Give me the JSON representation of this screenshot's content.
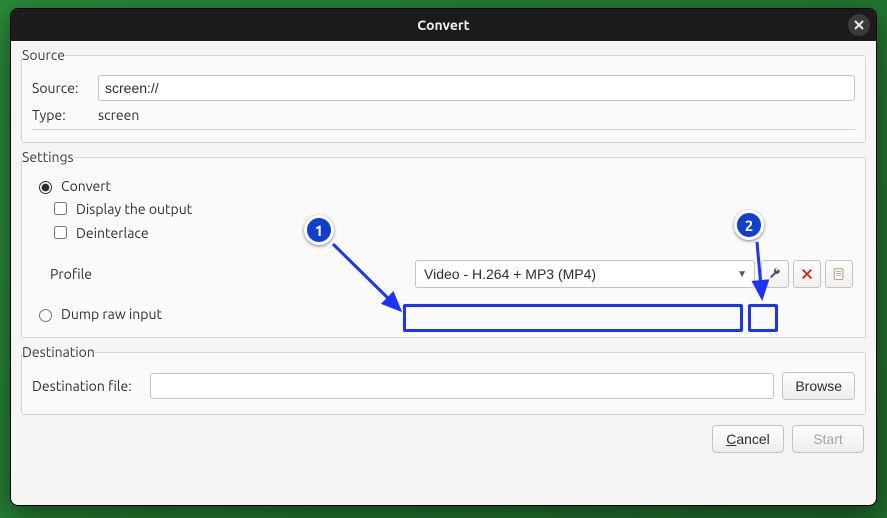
{
  "title": "Convert",
  "source_section": {
    "legend": "Source",
    "source_label": "Source:",
    "source_value": "screen://",
    "type_label": "Type:",
    "type_value": "screen"
  },
  "settings_section": {
    "legend": "Settings",
    "convert_radio": "Convert",
    "display_output_check": "Display the output",
    "deinterlace_check": "Deinterlace",
    "profile_label": "Profile",
    "profile_selected": "Video - H.264 + MP3 (MP4)",
    "dump_radio": "Dump raw input",
    "wrench_tooltip": "Edit selected profile",
    "delete_tooltip": "Delete selected profile",
    "new_tooltip": "Create a new profile"
  },
  "destination_section": {
    "legend": "Destination",
    "dest_label": "Destination file:",
    "dest_value": "",
    "browse_button": "Browse"
  },
  "footer": {
    "cancel_label": "Cancel",
    "cancel_mnemonic_index": 0,
    "start_label": "Start"
  },
  "annotations": {
    "one": "1",
    "two": "2"
  }
}
